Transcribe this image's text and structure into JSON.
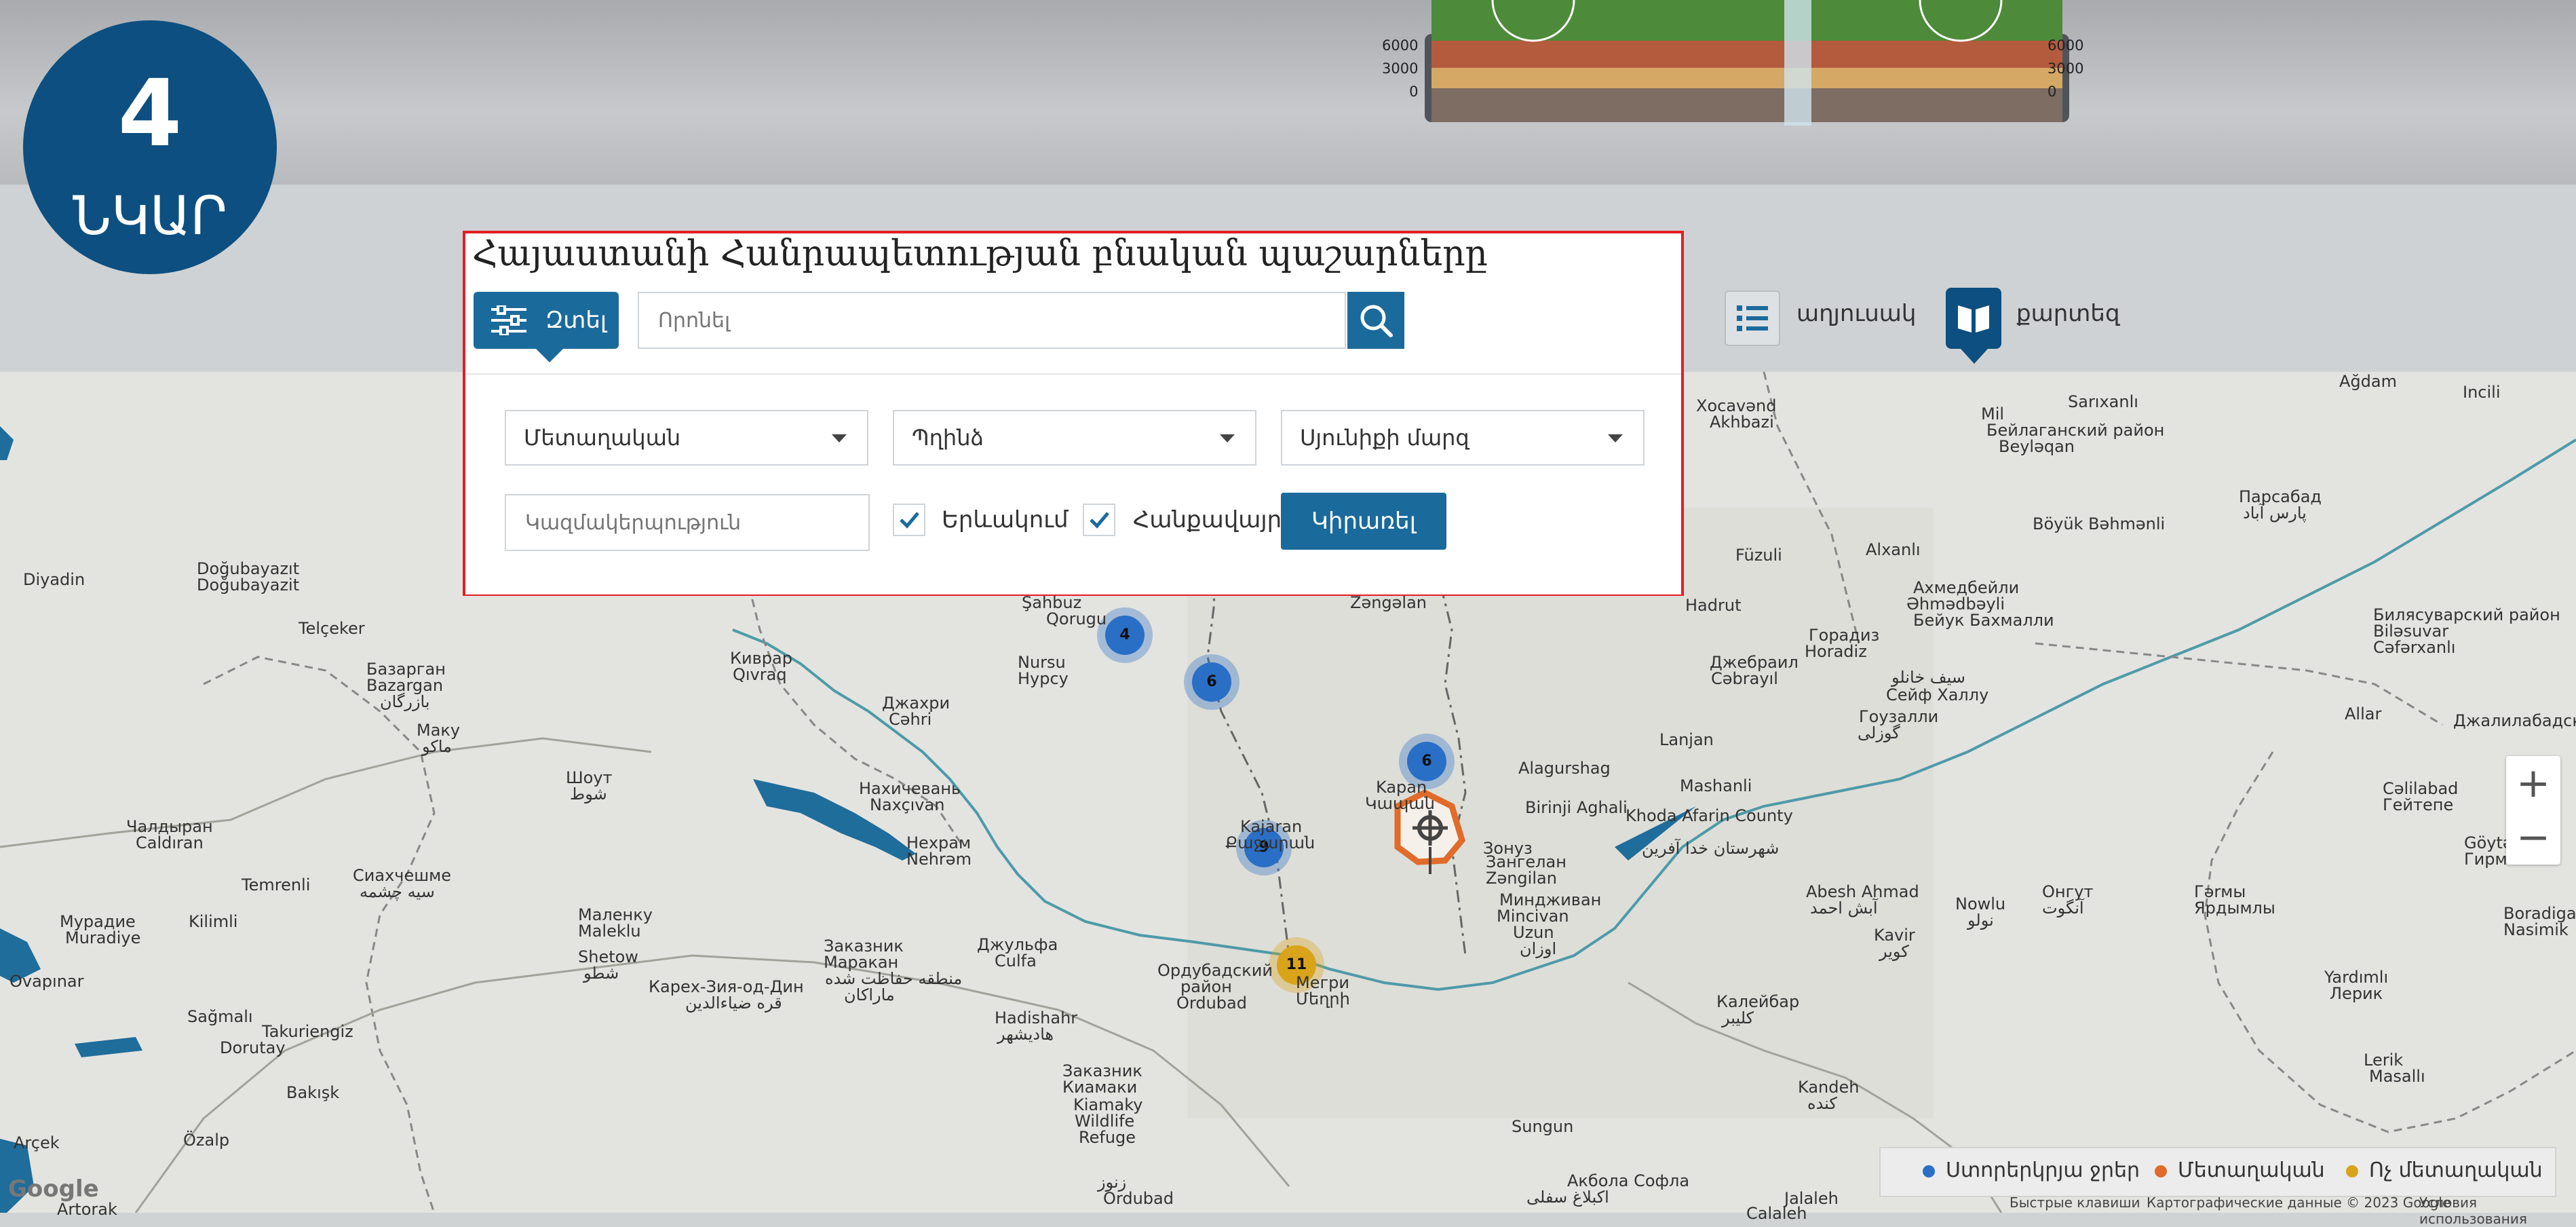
{
  "badge": {
    "number": "4",
    "text": "ՆԿԱՐ"
  },
  "hero": {
    "scale_left": [
      "6000",
      "3000",
      "0"
    ],
    "scale_right": [
      "6000",
      "3000",
      "0"
    ]
  },
  "panel": {
    "title": "Հայաստանի Հանրապետության բնական պաշարները",
    "filter_button": "Զտել",
    "search_placeholder": "Որոնել",
    "dropdowns": [
      "Մետաղական",
      "Պղինձ",
      "Սյունիքի մարզ"
    ],
    "organization_placeholder": "Կազմակերպություն",
    "checkboxes": [
      {
        "label": "Երևակում",
        "checked": true
      },
      {
        "label": "Հանքավայր",
        "checked": true
      }
    ],
    "apply_button": "Կիրառել"
  },
  "view_switch": {
    "list_label": "աղյուսակ",
    "map_label": "քարտեզ"
  },
  "map": {
    "place_labels": [
      "Diyadin",
      "Doğubayazıt",
      "Doğubayazit",
      "Telçeker",
      "Базарган",
      "Bazargan",
      "بازرگان",
      "Маку",
      "ماکو",
      "Шоут",
      "شوط",
      "Чалдыран",
      "Caldıran",
      "Temrenli",
      "Сиахчешме",
      "سیه چشمه",
      "Kilimli",
      "Мурадие",
      "Muradiye",
      "Маленку",
      "Maleklu",
      "Shetow",
      "شطو",
      "Карех-Зия-од-Дин",
      "قره ضیاءالدین",
      "Sağmalı",
      "Takuriengiz",
      "Dorutay",
      "Bakışk",
      "Özalp",
      "Ovapınar",
      "Arçek",
      "Artorak",
      "Киврар",
      "Qıvraq",
      "Джахри",
      "Cəhri",
      "Nursu",
      "Нурсу",
      "Şahbuz",
      "Qorugu",
      "Нахичевань",
      "Naxçıvan",
      "Нехрам",
      "Nehrəm",
      "Заказник",
      "Маракан",
      "منطقه حفاظت شده",
      "ماراکان",
      "Джульфа",
      "Culfa",
      "Hadishahr",
      "هادیشهر",
      "Заказник",
      "Киамаки",
      "Kiamaky",
      "Wildlife",
      "Refuge",
      "Ордубадский",
      "район",
      "Ordubad",
      "Мегри",
      "Մեղրի",
      "Kapan",
      "Կապան",
      "Kajaran",
      "Քաջարան",
      "Alagurshag",
      "Birinji Aghali",
      "Зангелан",
      "Zəngilan",
      "Миндживан",
      "Mincivan",
      "Uzun",
      "اوزان",
      "Khoda Afarin County",
      "شهرستان خدا آفرین",
      "Abesh Ahmad",
      "آبش احمد",
      "Kavir",
      "کویر",
      "Nowlu",
      "نولو",
      "Онгут",
      "آنگوت",
      "Calaleh",
      "Jalaleh",
      "Калейбар",
      "کلیبر",
      "Kandeh",
      "کنده",
      "Sungun",
      "Акбола Софла",
      "اکبلاغ سفلی",
      "Mashanli",
      "Lanjan",
      "Гоузалли",
      "گوزلی",
      "Сейф Халлу",
      "سیف خانلو",
      "Джебраил",
      "Cəbrayıl",
      "Горадиз",
      "Horadiz",
      "Füzuli",
      "Hadrut",
      "Alxanlı",
      "Ахмедбейли",
      "Əhmədbəyli",
      "Бейук Бахмалли",
      "Böyük Bəhmənli",
      "Mil",
      "Бейлаганский район",
      "Beyləqan",
      "Sarıxanlı",
      "Парсабад",
      "پارس آباد",
      "Билясуварский район",
      "Biləsuvar",
      "Cəfərxanlı",
      "Allar",
      "Джалилабадский район",
      "Cəlilabad",
      "Гейтепе",
      "Göytəpə",
      "Гирмы",
      "Гərмы",
      "Ярдымлы",
      "Yardımlı",
      "Лерик",
      "Lerik",
      "Masallı",
      "Boradigah",
      "Nasimik",
      "Incili",
      "Ağdam",
      "Xocavənd",
      "Akhbazi",
      "Zəngəlan",
      "Зонуз",
      "زنوز",
      "Ordubad"
    ],
    "clusters": [
      {
        "count": "4",
        "color": "#2a6fc6"
      },
      {
        "count": "6",
        "color": "#2a6fc6"
      },
      {
        "count": "6",
        "color": "#2a6fc6"
      },
      {
        "count": "9",
        "color": "#2a6fc6"
      },
      {
        "count": "11",
        "color": "#d9a31a"
      }
    ],
    "zoom_in": "+",
    "zoom_out": "−",
    "legend": [
      {
        "label": "Ստորերկրյա ջրեր",
        "color": "#2a6fc6"
      },
      {
        "label": "Մետաղական",
        "color": "#e06b2a"
      },
      {
        "label": "Ոչ մետաղական",
        "color": "#d9a31a"
      }
    ],
    "google_logo": "Google",
    "attribution": {
      "shortcuts": "Быстрые клавиши",
      "data": "Картографические данные © 2023 Google",
      "terms": "Условия использования"
    }
  }
}
